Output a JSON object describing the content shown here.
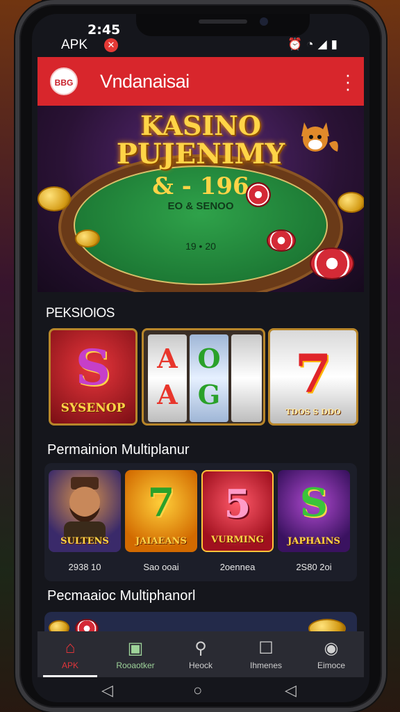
{
  "status": {
    "time": "2:45",
    "app_label": "APK",
    "record_badge": "✕",
    "icons": [
      "alarm-icon",
      "wifi-icon",
      "signal-icon",
      "battery-icon"
    ]
  },
  "appbar": {
    "logo_text": "BBG",
    "title": "Vndanaisai",
    "menu_icon": "more-vert-icon"
  },
  "banner": {
    "line1": "KASINO",
    "line2": "PUJENIMY",
    "amount": "& - 196",
    "sub": "EO & SENOO",
    "footer": "19 • 20"
  },
  "sections": {
    "first": "PEKSIOIOS",
    "second": "Permainion Multiplanur",
    "third": "Pecmaaioc Multiphanorl"
  },
  "featured": [
    {
      "label": "SYSENOP",
      "glyph": "S"
    },
    {
      "label": "",
      "glyph": "A A O G"
    },
    {
      "label": "7",
      "caption": "TDOS S DDO"
    }
  ],
  "multiplayer": [
    {
      "name": "SULTENS",
      "caption": "2938 10",
      "glyph": ""
    },
    {
      "name": "JAIAEANS",
      "caption": "Sao ooai",
      "glyph": "7"
    },
    {
      "name": "VURMING",
      "caption": "2oennea",
      "glyph": "5"
    },
    {
      "name": "JAPHAINS",
      "caption": "2S80 2oi",
      "glyph": "S"
    }
  ],
  "bottom_nav": [
    {
      "label": "APK",
      "icon": "home-icon"
    },
    {
      "label": "Rooaotker",
      "icon": "game-icon"
    },
    {
      "label": "Heock",
      "icon": "search-icon"
    },
    {
      "label": "Ihmenes",
      "icon": "square-icon"
    },
    {
      "label": "Eimoce",
      "icon": "profile-icon"
    }
  ],
  "colors": {
    "accent_red": "#d8262c",
    "gold": "#ffd447",
    "felt_green": "#1d7a35"
  }
}
